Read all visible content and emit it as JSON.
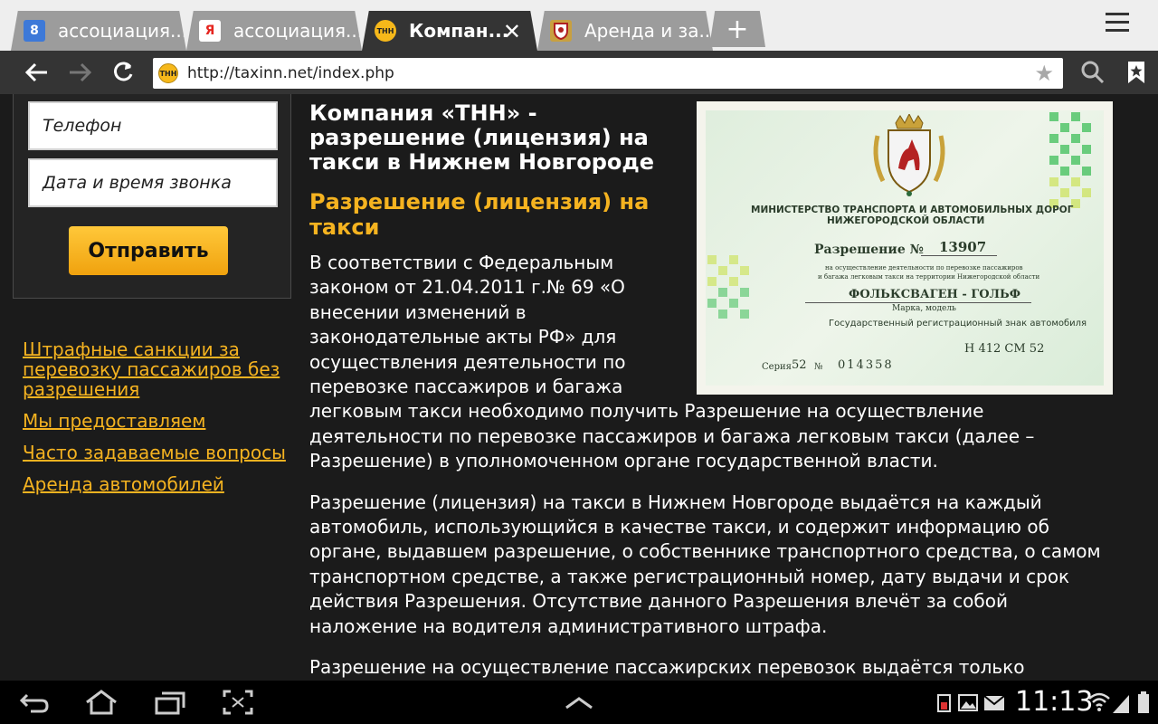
{
  "tabs": [
    {
      "title": "ассоциация...",
      "icon": "google-favicon-icon",
      "favicon_text": "8",
      "favicon_color": "#3d79d8"
    },
    {
      "title": "ассоциация...",
      "icon": "yandex-favicon-icon",
      "favicon_text": "Я",
      "favicon_color": "#ffffff"
    },
    {
      "title": "Компан...",
      "icon": "tnn-favicon-icon",
      "favicon_text": "ТНН",
      "favicon_color": "#f6b81a",
      "active": true
    },
    {
      "title": "Аренда и за...",
      "icon": "coat-of-arms-favicon-icon",
      "favicon_text": "",
      "favicon_color": "#c8a040"
    }
  ],
  "toolbar": {
    "url": "http://taxinn.net/index.php",
    "site_icon_text": "ТНН"
  },
  "form": {
    "phone_placeholder": "Телефон",
    "datetime_placeholder": "Дата и время звонка",
    "submit_label": "Отправить"
  },
  "sidebar_links": [
    "Штрафные санкции за перевозку пассажиров без разрешения",
    "Мы предоставляем",
    "Часто задаваемые вопросы",
    "Аренда автомобилей"
  ],
  "article": {
    "title": "Компания «ТНН» - разрешение (лицензия) на такси в Нижнем Новгороде",
    "subtitle": "Разрешение (лицензия) на такси",
    "p1": "В соответствии с Федеральным законом от 21.04.2011 г.№ 69 «О внесении изменений в законодательные акты РФ» для осуществления деятельности по перевозке пассажиров и багажа легковым такси необходимо получить Разрешение на осуществление деятельности по перевозке пассажиров и багажа легковым такси (далее – Разрешение) в уполномоченном органе государственной власти.",
    "p2": "Разрешение (лицензия) на такси в Нижнем Новгороде выдаётся на каждый автомобиль, использующийся в качестве такси, и содержит информацию об органе, выдавшем разрешение, о собственнике транспортного средства, о самом транспортном средстве, а также регистрационный номер, дату выдачи и срок действия Разрешения. Отсутствие данного Разрешения влечёт за собой наложение на водителя административного штрафа.",
    "p3": "Разрешение на осуществление пассажирских перевозок выдаётся только"
  },
  "permit": {
    "ministry_line1": "МИНИСТЕРСТВО ТРАНСПОРТА И АВТОМОБИЛЬНЫХ ДОРОГ",
    "ministry_line2": "НИЖЕГОРОДСКОЙ ОБЛАСТИ",
    "permit_label": "Разрешение №",
    "permit_number": "13907",
    "small_line1": "на осуществление деятельности по перевозке пассажиров",
    "small_line2": "и багажа легковым такси на территории Нижегородской области",
    "car_model": "ФОЛЬКСВАГЕН - ГОЛЬФ",
    "car_model_label": "Марка, модель",
    "reg_sign_label": "Государственный регистрационный знак автомобиля",
    "reg_sign": "Н 412 СМ 52",
    "series_label": "Серия",
    "series_value": "52",
    "number_label": "№",
    "number_value": "014358"
  },
  "status": {
    "time": "11:13"
  },
  "colors": {
    "accent": "#f5b320",
    "page_background": "#1b1b1b",
    "toolbar": "#343434"
  }
}
